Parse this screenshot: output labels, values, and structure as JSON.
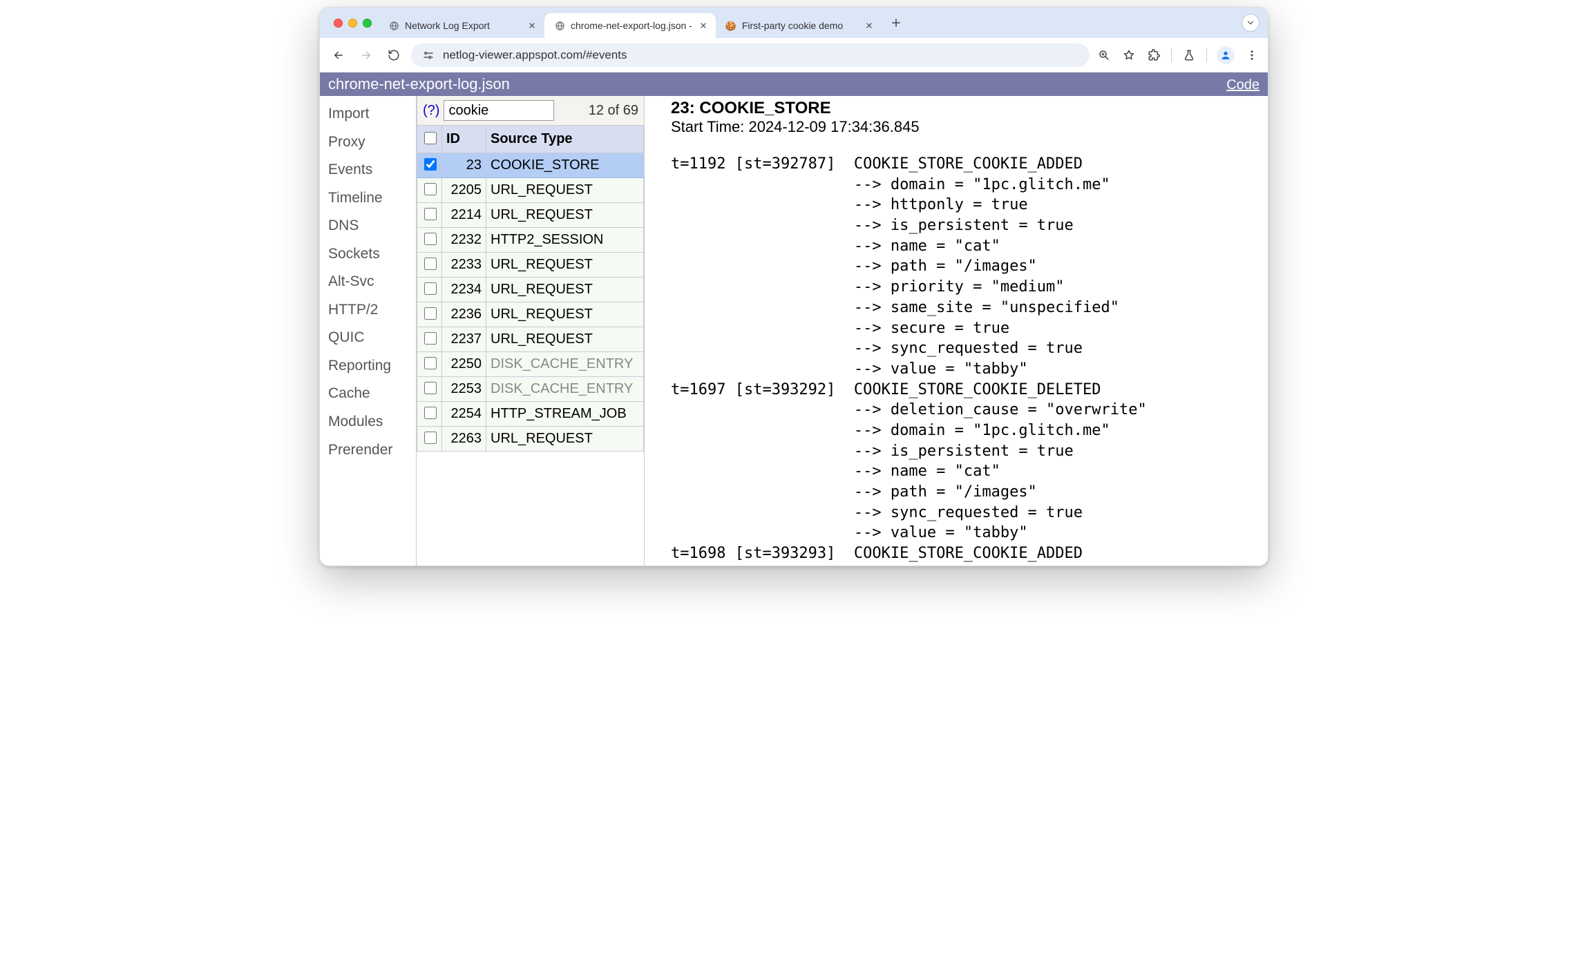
{
  "chrome": {
    "tabs": [
      {
        "title": "Network Log Export",
        "favicon": "globe",
        "active": false
      },
      {
        "title": "chrome-net-export-log.json - ",
        "favicon": "globe",
        "active": true
      },
      {
        "title": "First-party cookie demo",
        "favicon": "cookie",
        "active": false
      }
    ],
    "url": "netlog-viewer.appspot.com/#events"
  },
  "appbar": {
    "filename": "chrome-net-export-log.json",
    "link": "Code"
  },
  "sidebar": {
    "items": [
      "Import",
      "Proxy",
      "Events",
      "Timeline",
      "DNS",
      "Sockets",
      "Alt-Svc",
      "HTTP/2",
      "QUIC",
      "Reporting",
      "Cache",
      "Modules",
      "Prerender"
    ]
  },
  "filter": {
    "help": "(?)",
    "value": "cookie",
    "count": "12 of 69"
  },
  "headers": {
    "cb": "",
    "id": "ID",
    "src": "Source Type"
  },
  "rows": [
    {
      "id": "23",
      "src": "COOKIE_STORE",
      "selected": true,
      "dim": false
    },
    {
      "id": "2205",
      "src": "URL_REQUEST",
      "selected": false,
      "dim": false
    },
    {
      "id": "2214",
      "src": "URL_REQUEST",
      "selected": false,
      "dim": false
    },
    {
      "id": "2232",
      "src": "HTTP2_SESSION",
      "selected": false,
      "dim": false
    },
    {
      "id": "2233",
      "src": "URL_REQUEST",
      "selected": false,
      "dim": false
    },
    {
      "id": "2234",
      "src": "URL_REQUEST",
      "selected": false,
      "dim": false
    },
    {
      "id": "2236",
      "src": "URL_REQUEST",
      "selected": false,
      "dim": false
    },
    {
      "id": "2237",
      "src": "URL_REQUEST",
      "selected": false,
      "dim": false
    },
    {
      "id": "2250",
      "src": "DISK_CACHE_ENTRY",
      "selected": false,
      "dim": true
    },
    {
      "id": "2253",
      "src": "DISK_CACHE_ENTRY",
      "selected": false,
      "dim": true
    },
    {
      "id": "2254",
      "src": "HTTP_STREAM_JOB",
      "selected": false,
      "dim": false
    },
    {
      "id": "2263",
      "src": "URL_REQUEST",
      "selected": false,
      "dim": false
    }
  ],
  "detail": {
    "title": "23: COOKIE_STORE",
    "start": "Start Time: 2024-12-09 17:34:36.845",
    "body": "t=1192 [st=392787]  COOKIE_STORE_COOKIE_ADDED\n                    --> domain = \"1pc.glitch.me\"\n                    --> httponly = true\n                    --> is_persistent = true\n                    --> name = \"cat\"\n                    --> path = \"/images\"\n                    --> priority = \"medium\"\n                    --> same_site = \"unspecified\"\n                    --> secure = true\n                    --> sync_requested = true\n                    --> value = \"tabby\"\nt=1697 [st=393292]  COOKIE_STORE_COOKIE_DELETED\n                    --> deletion_cause = \"overwrite\"\n                    --> domain = \"1pc.glitch.me\"\n                    --> is_persistent = true\n                    --> name = \"cat\"\n                    --> path = \"/images\"\n                    --> sync_requested = true\n                    --> value = \"tabby\"\nt=1698 [st=393293]  COOKIE_STORE_COOKIE_ADDED"
  }
}
